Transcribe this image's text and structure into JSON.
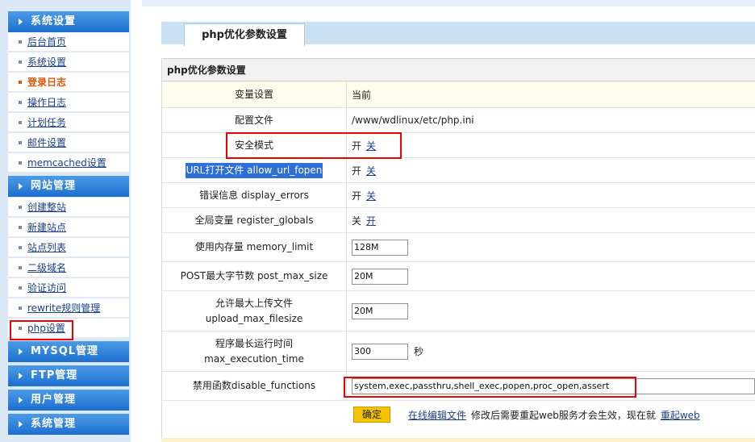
{
  "sidebar": {
    "sections": [
      {
        "label": "系统设置"
      },
      {
        "label": "网站管理"
      },
      {
        "label": "MYSQL管理"
      },
      {
        "label": "FTP管理"
      },
      {
        "label": "用户管理"
      },
      {
        "label": "系统管理"
      }
    ],
    "system_items": [
      "后台首页",
      "系统设置",
      "登录日志",
      "操作日志",
      "计划任务",
      "邮件设置",
      "memcached设置"
    ],
    "site_items": [
      "创建整站",
      "新建站点",
      "站点列表",
      "二级域名",
      "验证访问",
      "rewrite规则管理",
      "php设置"
    ]
  },
  "tab": {
    "label": "php优化参数设置"
  },
  "panel": {
    "title": "php优化参数设置"
  },
  "table": {
    "header": {
      "left": "变量设置",
      "right": "当前"
    },
    "config_file": {
      "label": "配置文件",
      "value": "/www/wdlinux/etc/php.ini"
    },
    "safe_mode": {
      "label": "安全模式",
      "current": "开",
      "option": "关"
    },
    "url_fopen": {
      "label": "URL打开文件 allow_url_fopen",
      "current": "开",
      "option": "关"
    },
    "display_errors": {
      "label": "错误信息 display_errors",
      "current": "开",
      "option": "关"
    },
    "register_globals": {
      "label": "全局变量 register_globals",
      "current": "关",
      "option": "开"
    },
    "memory_limit": {
      "label": "使用内存量 memory_limit",
      "value": "128M"
    },
    "post_max_size": {
      "label": "POST最大字节数 post_max_size",
      "value": "20M"
    },
    "upload_max_filesize": {
      "label_line1": "允许最大上传文件",
      "label_line2": "upload_max_filesize",
      "value": "20M"
    },
    "max_execution_time": {
      "label_line1": "程序最长运行时间",
      "label_line2": "max_execution_time",
      "value": "300",
      "unit": "秒"
    },
    "disable_functions": {
      "label": "禁用函数disable_functions",
      "value": "system,exec,passthru,shell_exec,popen,proc_open,assert"
    }
  },
  "actions": {
    "confirm": "确定",
    "edit_link": "在线编辑文件",
    "note": "修改后需要重起web服务才会生效，现在就",
    "restart_link": "重起web"
  },
  "colors": {
    "accent": "#1c6fcf",
    "highlight_box": "#e00000",
    "button": "#f5c400",
    "active_nav": "#e2560b"
  }
}
